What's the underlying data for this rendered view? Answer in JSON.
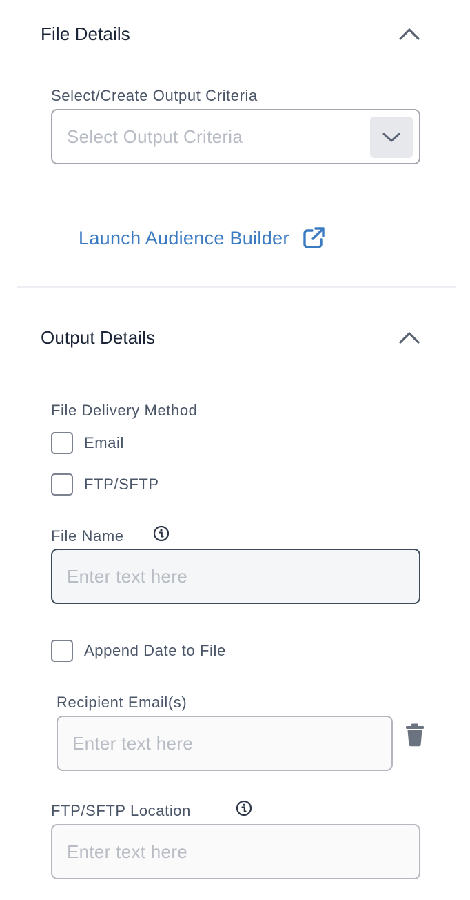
{
  "file_details": {
    "title": "File Details",
    "output_criteria_label": "Select/Create Output Criteria",
    "output_criteria_placeholder": "Select Output Criteria",
    "launch_link": "Launch Audience Builder"
  },
  "output_details": {
    "title": "Output Details",
    "delivery_method_label": "File Delivery Method",
    "delivery_options": [
      "Email",
      "FTP/SFTP"
    ],
    "file_name_label": "File Name",
    "file_name_placeholder": "Enter text here",
    "append_date_label": "Append Date to File",
    "recipient_label": "Recipient Email(s)",
    "recipient_placeholder": "Enter text here",
    "ftp_location_label": "FTP/SFTP Location",
    "ftp_location_placeholder": "Enter text here"
  },
  "icons": {
    "collapse": "chevron-up-icon",
    "dropdown": "chevron-down-icon",
    "external": "external-link-icon",
    "info": "info-icon",
    "delete": "trash-icon"
  },
  "colors": {
    "link": "#3b7bc2",
    "title": "#1b2436",
    "label": "#4a5568",
    "placeholder": "#b8bcc4",
    "border": "#a3a8b0",
    "icon": "#6b7280"
  }
}
